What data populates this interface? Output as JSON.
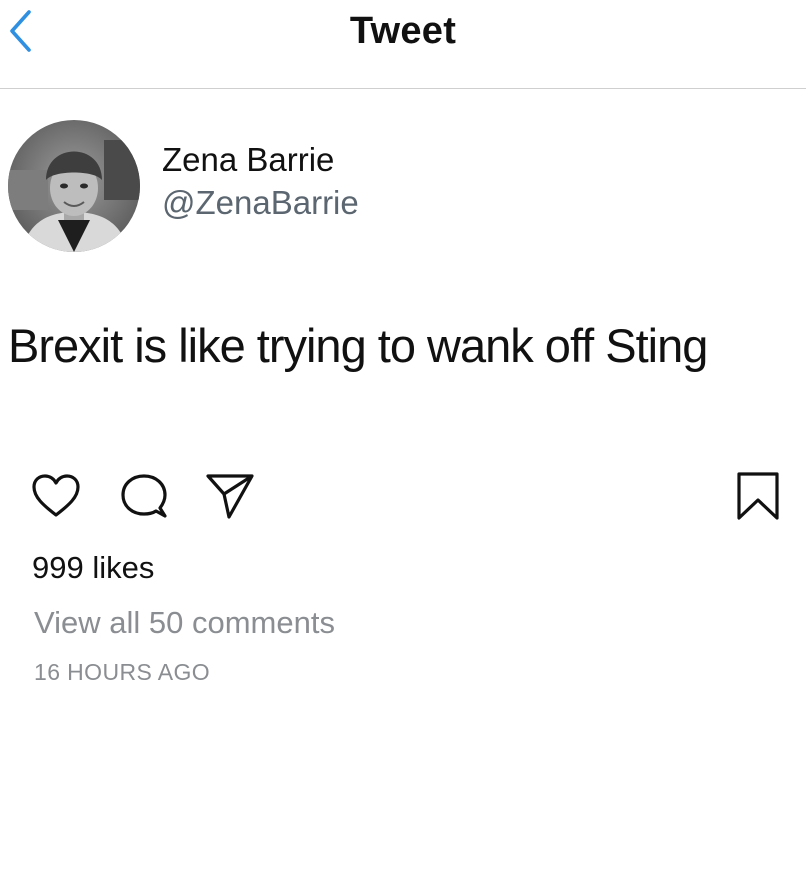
{
  "nav": {
    "back_icon": "chevron-left-icon",
    "title": "Tweet",
    "accent_color": "#2f8fe0"
  },
  "author": {
    "display_name": "Zena Barrie",
    "handle": "@ZenaBarrie"
  },
  "tweet": {
    "text": "Brexit is like trying to wank off Sting"
  },
  "actions": {
    "like_icon": "heart-icon",
    "comment_icon": "comment-bubble-icon",
    "share_icon": "send-paper-plane-icon",
    "save_icon": "bookmark-icon"
  },
  "stats": {
    "likes": "999 likes",
    "comments_link": "View all 50 comments",
    "time_ago": "16 HOURS AGO"
  }
}
